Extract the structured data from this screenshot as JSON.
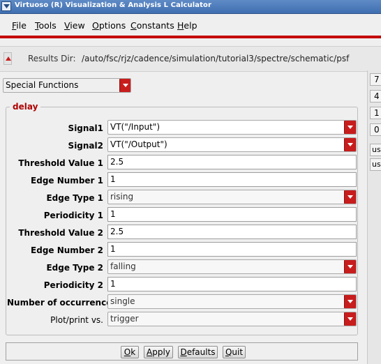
{
  "window": {
    "title": "Virtuoso (R) Visualization & Analysis L Calculator"
  },
  "menubar": {
    "file": {
      "mn": "F",
      "rest": "ile"
    },
    "tools": {
      "mn": "T",
      "rest": "ools"
    },
    "view": {
      "mn": "V",
      "rest": "iew"
    },
    "options": {
      "mn": "O",
      "rest": "ptions"
    },
    "constants": {
      "mn": "C",
      "rest": "onstants"
    },
    "help": {
      "mn": "H",
      "rest": "elp"
    }
  },
  "results": {
    "label": "Results Dir:",
    "path": "/auto/fsc/rjz/cadence/simulation/tutorial3/spectre/schematic/psf"
  },
  "keypad": [
    "7",
    "4",
    "1",
    "0"
  ],
  "unit_keys": [
    "us",
    "us"
  ],
  "function_category": "Special Functions",
  "form": {
    "title": "delay",
    "signal1": {
      "label": "Signal1",
      "value": "VT(\"/Input\")"
    },
    "signal2": {
      "label": "Signal2",
      "value": "VT(\"/Output\")"
    },
    "threshold1": {
      "label": "Threshold Value 1",
      "value": "2.5"
    },
    "edge_number1": {
      "label": "Edge Number 1",
      "value": "1"
    },
    "edge_type1": {
      "label": "Edge Type 1",
      "value": "rising"
    },
    "periodicity1": {
      "label": "Periodicity 1",
      "value": "1"
    },
    "threshold2": {
      "label": "Threshold Value 2",
      "value": "2.5"
    },
    "edge_number2": {
      "label": "Edge Number 2",
      "value": "1"
    },
    "edge_type2": {
      "label": "Edge Type 2",
      "value": "falling"
    },
    "periodicity2": {
      "label": "Periodicity 2",
      "value": "1"
    },
    "occurrences": {
      "label": "Number of occurrences",
      "value": "single"
    },
    "plot_print": {
      "label": "Plot/print vs.",
      "value": "trigger"
    }
  },
  "buttons": {
    "ok": {
      "mn": "O",
      "rest": "k"
    },
    "apply": {
      "mn": "A",
      "rest": "pply"
    },
    "defaults": {
      "mn": "D",
      "rest": "efaults"
    },
    "quit": {
      "mn": "Q",
      "rest": "uit"
    }
  },
  "colors": {
    "accent": "#c81d1d",
    "titlebar": "#4a79bb",
    "group_title": "#b00000"
  }
}
